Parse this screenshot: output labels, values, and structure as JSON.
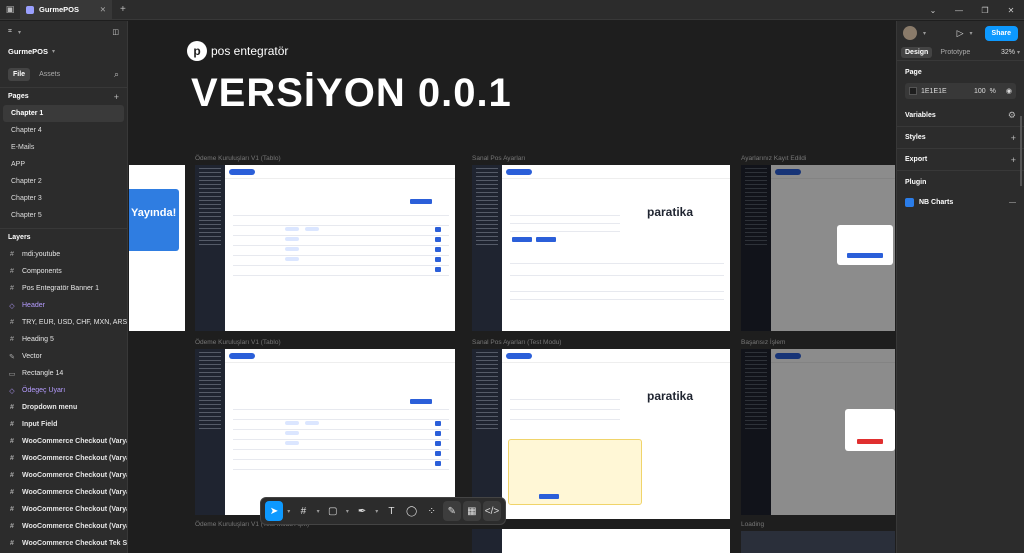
{
  "app": {
    "tab_title": "GurmePOS",
    "project_name": "GurmePOS"
  },
  "left": {
    "file_tab": "File",
    "assets_tab": "Assets",
    "pages_title": "Pages",
    "pages": [
      "Chapter 1",
      "Chapter 4",
      "E-Mails",
      "APP",
      "Chapter 2",
      "Chapter 3",
      "Chapter 5"
    ],
    "layers_title": "Layers",
    "layers": [
      {
        "icon": "#",
        "label": "mdi:youtube"
      },
      {
        "icon": "#",
        "label": "Components"
      },
      {
        "icon": "#",
        "label": "Pos Entegratör Banner 1"
      },
      {
        "icon": "◇",
        "label": "Header"
      },
      {
        "icon": "#",
        "label": "TRY, EUR, USD, CHF, MXN, ARS, SAR,"
      },
      {
        "icon": "#",
        "label": "Heading 5"
      },
      {
        "icon": "✎",
        "label": "Vector"
      },
      {
        "icon": "▭",
        "label": "Rectangle 14"
      },
      {
        "icon": "◇",
        "label": "Ödegeç Uyarı"
      },
      {
        "icon": "#",
        "label": "Dropdown menu"
      },
      {
        "icon": "#",
        "label": "Input Field"
      },
      {
        "icon": "#",
        "label": "WooCommerce Checkout (Varyasyon"
      },
      {
        "icon": "#",
        "label": "WooCommerce Checkout (Varyasyon"
      },
      {
        "icon": "#",
        "label": "WooCommerce Checkout (Varyasyon"
      },
      {
        "icon": "#",
        "label": "WooCommerce Checkout (Varyasyon"
      },
      {
        "icon": "#",
        "label": "WooCommerce Checkout (Varyasyon"
      },
      {
        "icon": "#",
        "label": "WooCommerce Checkout (Varyasyon"
      },
      {
        "icon": "#",
        "label": "WooCommerce Checkout Tek Satır (V"
      }
    ]
  },
  "canvas": {
    "logo_text": "pos entegratör",
    "title": "VERSİYON 0.0.1",
    "frames": {
      "f1": "Ödeme Kuruluşları V1 (Tablo)",
      "f2": "Sanal Pos Ayarları",
      "f3": "Ayarlarınız Kayıt Edildi",
      "f4": "Ödeme Kuruluşları V1 (Tablo)",
      "f5": "Sanal Pos Ayarları (Test Modu)",
      "f6": "Başarısız İşlem",
      "f7": "Ödeme Kuruluşları V1 (Test Modu Açık)",
      "f8": "Loading"
    },
    "banner_text": "Yayında!",
    "brand_text": "paratika"
  },
  "right": {
    "share_label": "Share",
    "design_tab": "Design",
    "prototype_tab": "Prototype",
    "zoom": "32%",
    "page_section": "Page",
    "page_color": "1E1E1E",
    "page_opacity": "100",
    "page_opacity_unit": "%",
    "variables": "Variables",
    "styles": "Styles",
    "export": "Export",
    "plugin": "Plugin",
    "plugin_name": "NB Charts"
  },
  "colors": {
    "accent": "#0d99ff",
    "canvas_bg": "#1e1e1e",
    "panel_bg": "#2c2c2c",
    "purple_component": "#b59cff"
  }
}
